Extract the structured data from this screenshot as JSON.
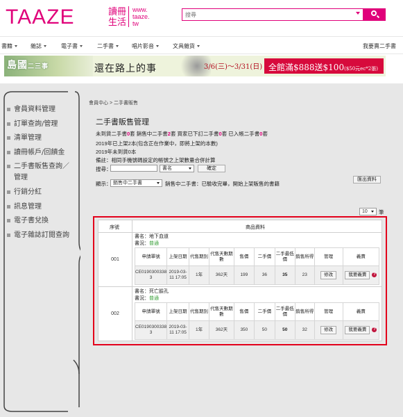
{
  "header": {
    "logo": "TAAZE",
    "brand_cn_line1": "讀冊",
    "brand_cn_line2": "生活",
    "brand_url_line1": "www.",
    "brand_url_line2": "taaze.",
    "brand_url_line3": "tw",
    "search_placeholder": "搜尋"
  },
  "nav": {
    "items": [
      "書籍",
      "雜誌",
      "電子書",
      "二手書",
      "唱片影音",
      "文具雜貨"
    ],
    "right_link": "我要賣二手書"
  },
  "banner": {
    "title": "島國",
    "title_small": "二三事",
    "subtitle": "還在路上的事",
    "date": "3/6(三)～3/31(日)",
    "promo": "全館滿$888送$100",
    "promo_small": "($50元ec*2張)"
  },
  "sidebar": {
    "items": [
      "會員資料管理",
      "訂單查詢/管理",
      "清單管理",
      "讀冊帳戶/回饋金",
      "二手書販售查詢／管理",
      "行銷分紅",
      "訊息管理",
      "電子書兌換",
      "電子雜誌訂閱查詢"
    ]
  },
  "main": {
    "breadcrumb": "會員中心 > 二手書販售",
    "title": "二手書販售管理",
    "status": {
      "p1": "未到貨二手書",
      "n1": "0",
      "p2": "套 銷售中二手書",
      "n2": "2",
      "p3": "套 買家已下訂二手書",
      "n3": "0",
      "p4": "套 已入帳二手書",
      "n4": "0",
      "p5": "套"
    },
    "line_2019_listed": "2019年已上架2本(包含正在作業中，即將上架的本數)",
    "line_2019_pending": "2019年未到貨0本",
    "note": "備註：相同手機號碼設定的帳號之上架數量合併計算",
    "search_label": "搜尋：",
    "search_field_value": "書名",
    "confirm_button": "確定",
    "display_label": "顯示：",
    "display_value": "銷售中二手書",
    "display_note": "銷售中二手書：已驗收完畢，開始上架販售的書籍",
    "export_button": "匯出資料",
    "per_page": "10",
    "per_page_unit": "筆",
    "table": {
      "col_no": "序號",
      "col_info": "商品資料",
      "sub_headers": [
        "申請單號",
        "上架日期",
        "代售期別",
        "代售天數期數",
        "售價",
        "二手價",
        "二手最低價",
        "銷售所得",
        "管理",
        "義賣"
      ],
      "rows": [
        {
          "no": "001",
          "book_label": "書名：",
          "book": "地下血道",
          "cond_label": "書況：",
          "cond": "普通",
          "order_no": "CE0190300338 3",
          "date": "2019-03-11 17:05",
          "period": "1年",
          "days": "362天",
          "price": "199",
          "used_price": "36",
          "min_price": "35",
          "income": "23",
          "manage_btn": "修改",
          "charity_btn": "我要義賣"
        },
        {
          "no": "002",
          "book_label": "書名：",
          "book": "死亡臉孔",
          "cond_label": "書況：",
          "cond": "普通",
          "order_no": "CE0190300338 3",
          "date": "2019-03-11 17:05",
          "period": "1年",
          "days": "362天",
          "price": "350",
          "used_price": "50",
          "min_price": "50",
          "income": "32",
          "manage_btn": "修改",
          "charity_btn": "我要義賣"
        }
      ]
    }
  },
  "colors": {
    "brand": "#e0007a",
    "highlight_box": "#e3001b",
    "condition": "#3aa03a"
  }
}
